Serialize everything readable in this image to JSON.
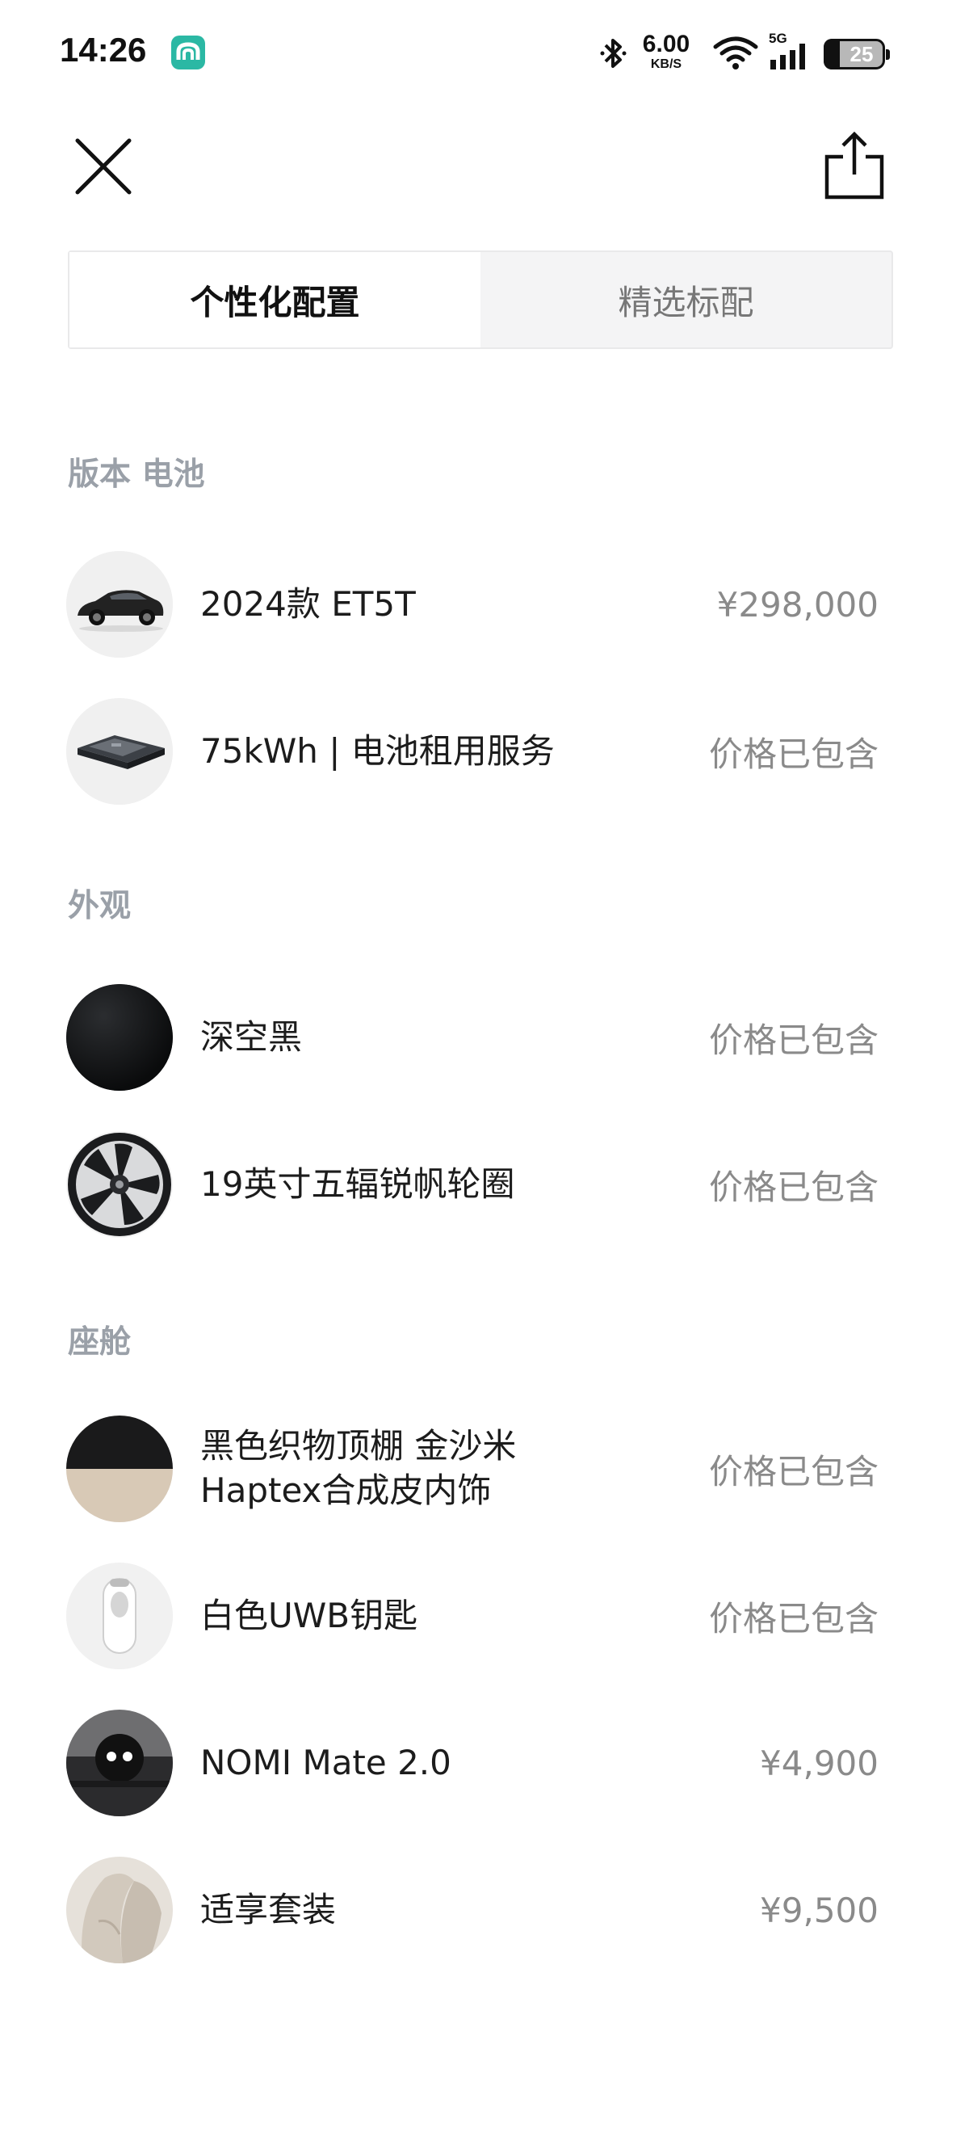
{
  "status_bar": {
    "time": "14:26",
    "net_speed_value": "6.00",
    "net_speed_unit": "KB/S",
    "signal_label": "5G",
    "battery_level": "25"
  },
  "header": {
    "close_icon": "close-icon",
    "share_icon": "share-icon"
  },
  "tabs": [
    {
      "label": "个性化配置",
      "active": true
    },
    {
      "label": "精选标配",
      "active": false
    }
  ],
  "sections": {
    "version": {
      "title": "版本 电池",
      "items": [
        {
          "label": "2024款 ET5T",
          "price": "¥298,000"
        },
        {
          "label": "75kWh | 电池租用服务",
          "price": "价格已包含"
        }
      ]
    },
    "exterior": {
      "title": "外观",
      "items": [
        {
          "label": "深空黑",
          "price": "价格已包含"
        },
        {
          "label": "19英寸五辐锐帆轮圈",
          "price": "价格已包含"
        }
      ]
    },
    "cabin": {
      "title": "座舱",
      "items": [
        {
          "label": "黑色织物顶棚 金沙米\nHaptex合成皮内饰",
          "price": "价格已包含"
        },
        {
          "label": "白色UWB钥匙",
          "price": "价格已包含"
        },
        {
          "label": "NOMI Mate 2.0",
          "price": "¥4,900"
        },
        {
          "label": "适享套装",
          "price": "¥9,500"
        }
      ]
    }
  },
  "colors": {
    "section_title": "#9aa0a8",
    "price_text": "#8a8a8a",
    "app_badge": "#2bb8a4"
  }
}
